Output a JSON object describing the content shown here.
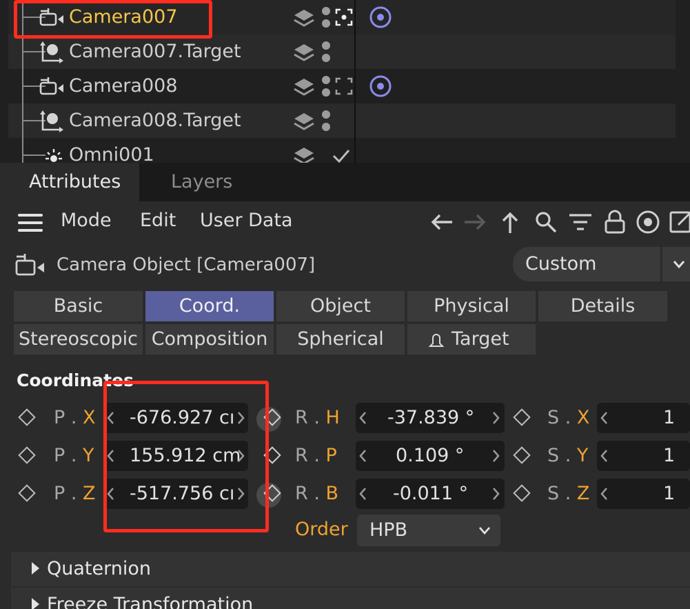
{
  "object_manager": {
    "objects": [
      {
        "name": "Camera007",
        "icon": "camera-icon",
        "active": true
      },
      {
        "name": "Camera007.Target",
        "icon": "target-null-icon"
      },
      {
        "name": "Camera008",
        "icon": "camera-icon"
      },
      {
        "name": "Camera008.Target",
        "icon": "target-null-icon"
      },
      {
        "name": "Omni001",
        "icon": "light-icon"
      }
    ],
    "active_color": "#f6c648",
    "tag_color": "#8a8cf0"
  },
  "panel_tabs": [
    "Attributes",
    "Layers"
  ],
  "menu": {
    "mode": "Mode",
    "edit": "Edit",
    "user_data": "User Data"
  },
  "header": {
    "title": "Camera Object [Camera007]",
    "preset": "Custom"
  },
  "attr_tabs": [
    "Basic",
    "Coord.",
    "Object",
    "Physical",
    "Details",
    "Stereoscopic",
    "Composition",
    "Spherical",
    "Target"
  ],
  "active_tab": "Coord.",
  "active_tab_color": "#5a5f9e",
  "coordinates": {
    "section": "Coordinates",
    "p": [
      {
        "label": "P",
        "axis": "X",
        "value": "-676.927 cı"
      },
      {
        "label": "P",
        "axis": "Y",
        "value": "155.912 cm"
      },
      {
        "label": "P",
        "axis": "Z",
        "value": "-517.756 cı"
      }
    ],
    "r": [
      {
        "label": "R",
        "axis": "H",
        "value": "-37.839 °"
      },
      {
        "label": "R",
        "axis": "P",
        "value": "0.109 °"
      },
      {
        "label": "R",
        "axis": "B",
        "value": "-0.011 °"
      }
    ],
    "s": [
      {
        "label": "S",
        "axis": "X",
        "value": "1"
      },
      {
        "label": "S",
        "axis": "Y",
        "value": "1"
      },
      {
        "label": "S",
        "axis": "Z",
        "value": "1"
      }
    ],
    "order_label": "Order",
    "order_value": "HPB",
    "accent_color": "#f0a330"
  },
  "groups": [
    "Quaternion",
    "Freeze Transformation"
  ],
  "highlight_color": "#ff2d20"
}
